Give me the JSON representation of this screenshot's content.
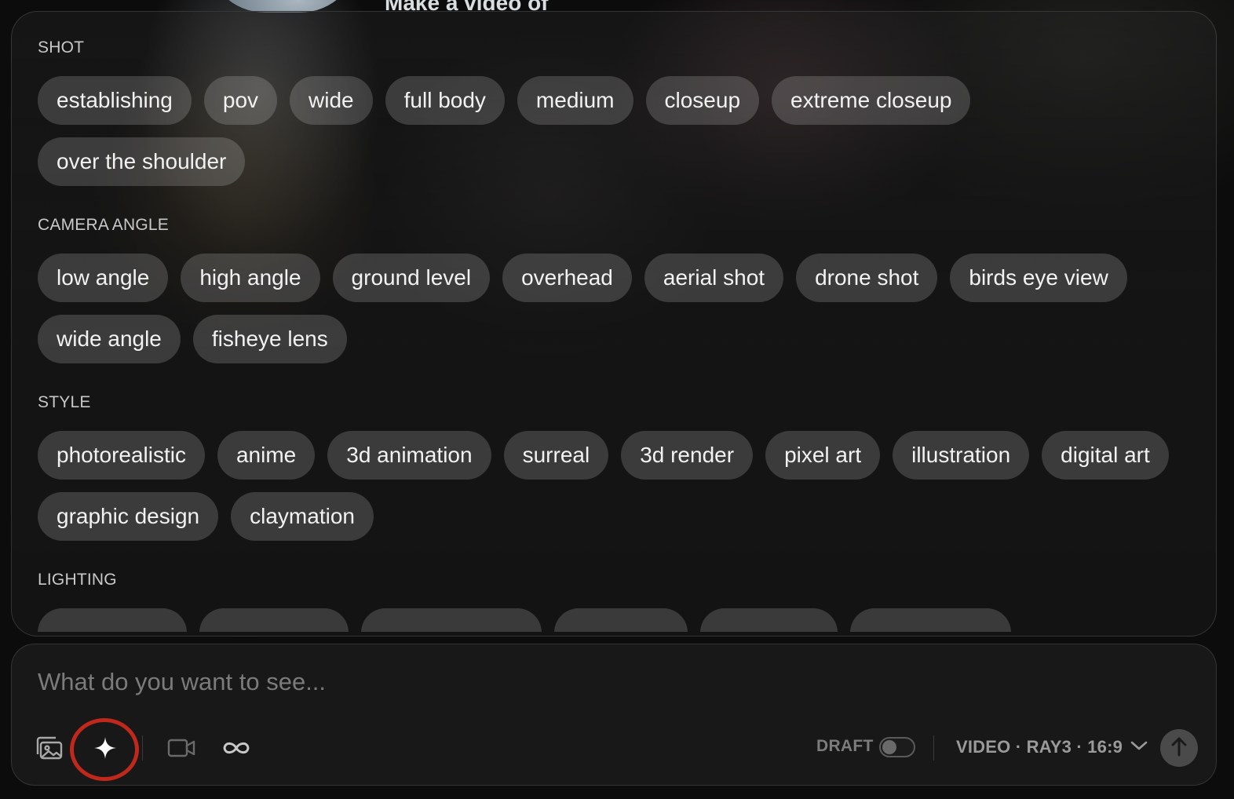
{
  "header": {
    "title": "Make a video of"
  },
  "sections": [
    {
      "label": "SHOT",
      "chips": [
        "establishing",
        "pov",
        "wide",
        "full body",
        "medium",
        "closeup",
        "extreme closeup",
        "over the shoulder"
      ]
    },
    {
      "label": "CAMERA ANGLE",
      "chips": [
        "low angle",
        "high angle",
        "ground level",
        "overhead",
        "aerial shot",
        "drone shot",
        "birds eye view",
        "wide angle",
        "fisheye lens"
      ]
    },
    {
      "label": "STYLE",
      "chips": [
        "photorealistic",
        "anime",
        "3d animation",
        "surreal",
        "3d render",
        "pixel art",
        "illustration",
        "digital art",
        "graphic design",
        "claymation"
      ]
    },
    {
      "label": "LIGHTING",
      "chips": []
    }
  ],
  "composer": {
    "placeholder": "What do you want to see...",
    "draft_label": "DRAFT",
    "draft_enabled": false,
    "model_label": "VIDEO · RAY3 · 16:9",
    "icons": {
      "image": "image-gallery-icon",
      "sparkle": "sparkle-icon",
      "video": "video-camera-icon",
      "loop": "infinity-loop-icon",
      "chevron": "chevron-down-icon",
      "submit": "arrow-up-icon"
    },
    "highlight_color": "#c0281c"
  }
}
